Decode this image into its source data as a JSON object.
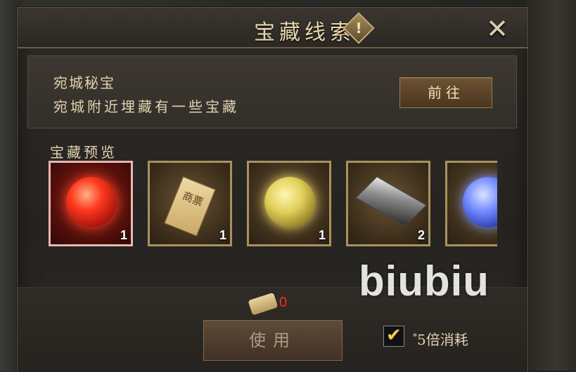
{
  "dialog": {
    "title": "宝藏线索",
    "info_icon_glyph": "!",
    "close_icon": "close-icon"
  },
  "quest": {
    "name": "宛城秘宝",
    "description": "宛城附近埋藏有一些宝藏",
    "go_button_label": "前往"
  },
  "preview": {
    "label": "宝藏预览",
    "items": [
      {
        "icon": "red-orb-icon",
        "count": "1"
      },
      {
        "icon": "merchant-ticket-icon",
        "count": "1",
        "glyph_text": "商票"
      },
      {
        "icon": "gold-orb-icon",
        "count": "1"
      },
      {
        "icon": "iron-ingot-icon",
        "count": "2"
      },
      {
        "icon": "blue-orb-icon",
        "count": ""
      }
    ]
  },
  "footer": {
    "scroll_count": "0",
    "use_button_label": "使用",
    "checkbox_checked": true,
    "multiplier_asterisk": "*",
    "multiplier_label": "5倍消耗"
  },
  "watermark": "biubiu",
  "colors": {
    "accent_gold": "#e4d3b1",
    "count_red": "#ff2a1a",
    "check_yellow": "#f2cf4a"
  }
}
